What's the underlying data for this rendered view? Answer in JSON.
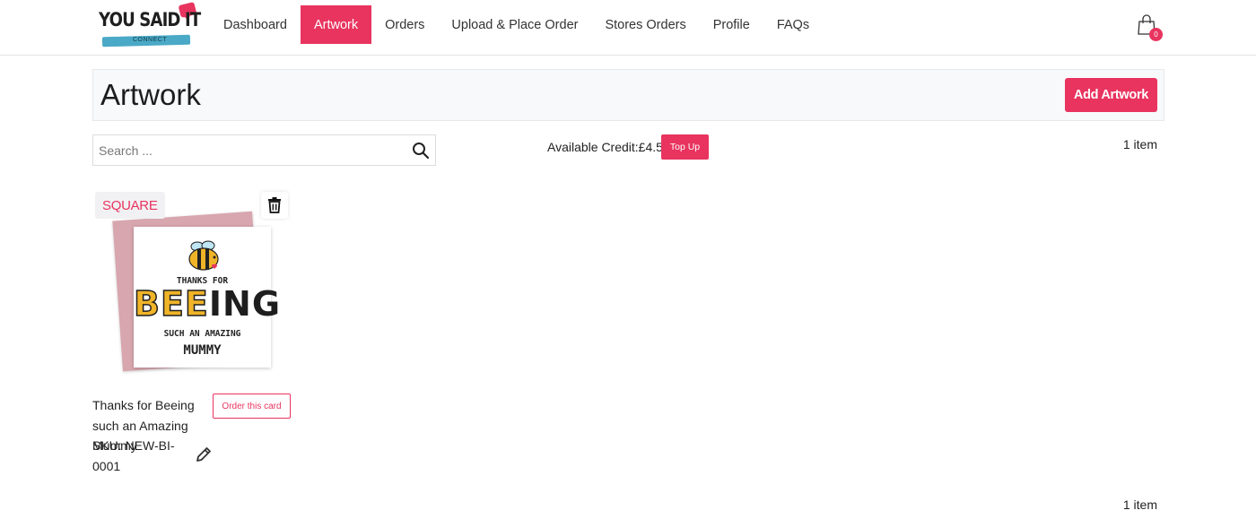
{
  "header": {
    "logo_text": "YOU SAID IT",
    "logo_sub": "CONNECT",
    "nav": [
      {
        "label": "Dashboard",
        "active": false
      },
      {
        "label": "Artwork",
        "active": true
      },
      {
        "label": "Orders",
        "active": false
      },
      {
        "label": "Upload & Place Order",
        "active": false
      },
      {
        "label": "Stores Orders",
        "active": false
      },
      {
        "label": "Profile",
        "active": false
      },
      {
        "label": "FAQs",
        "active": false
      }
    ],
    "cart_count": "0",
    "cart_icon": "shopping-bag-icon"
  },
  "page": {
    "title": "Artwork",
    "add_button": "Add Artwork"
  },
  "toolbar": {
    "search_placeholder": "Search ...",
    "search_icon": "search-icon",
    "credit_text": "Available Credit:£4.54",
    "topup_label": "Top Up",
    "item_count": "1 item"
  },
  "product": {
    "badge": "SQUARE",
    "image_text": {
      "line1": "THANKS FOR",
      "line2_yellow": "BEE",
      "line2_dark": "ING",
      "line3": "SUCH AN AMAZING",
      "line4": "MUMMY"
    },
    "name": "Thanks for Beeing such an Amazing Mummy",
    "sku": "SKU: NEW-BI-0001",
    "order_button": "Order this card"
  },
  "footer": {
    "item_count": "1 item"
  },
  "colors": {
    "accent": "#e8345f",
    "logo_stripe": "#4aa9c6",
    "envelope": "#d8a6ae"
  }
}
